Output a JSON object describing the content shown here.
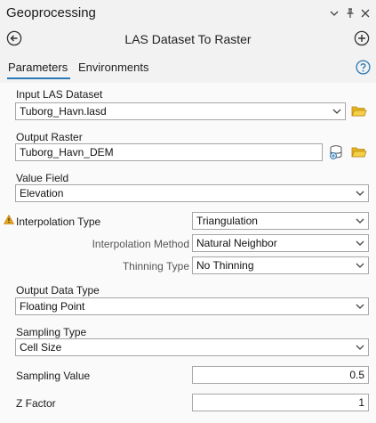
{
  "pane": {
    "title": "Geoprocessing",
    "menu_glyph": "⌄",
    "pin_glyph": "⊥",
    "close_glyph": "✕"
  },
  "tool": {
    "title": "LAS Dataset To Raster",
    "back_icon": "back-arrow-icon",
    "add_icon": "add-icon"
  },
  "tabs": {
    "parameters": "Parameters",
    "environments": "Environments",
    "help_icon": "help-icon"
  },
  "params": {
    "input_las": {
      "label": "Input LAS Dataset",
      "value": "Tuborg_Havn.lasd"
    },
    "output_raster": {
      "label": "Output Raster",
      "value": "Tuborg_Havn_DEM"
    },
    "value_field": {
      "label": "Value Field",
      "value": "Elevation"
    },
    "interpolation_type": {
      "label": "Interpolation Type",
      "value": "Triangulation"
    },
    "interpolation_method": {
      "label": "Interpolation Method",
      "value": "Natural Neighbor"
    },
    "thinning_type": {
      "label": "Thinning Type",
      "value": "No Thinning"
    },
    "output_data_type": {
      "label": "Output Data Type",
      "value": "Floating Point"
    },
    "sampling_type": {
      "label": "Sampling Type",
      "value": "Cell Size"
    },
    "sampling_value": {
      "label": "Sampling Value",
      "value": "0.5"
    },
    "z_factor": {
      "label": "Z Factor",
      "value": "1"
    }
  },
  "colors": {
    "accent": "#2b78b5",
    "warning": "#e8a317",
    "folder": "#e6b422"
  }
}
